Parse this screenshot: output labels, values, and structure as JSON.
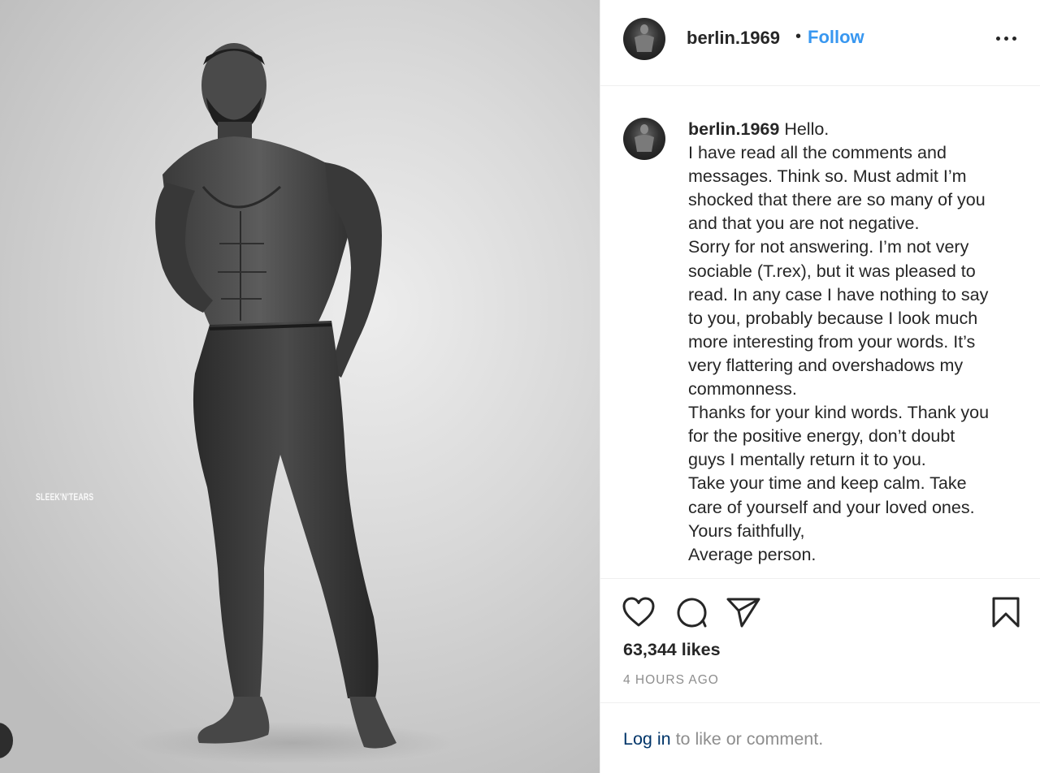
{
  "photo": {
    "watermark": "SLEEK'N'TEARS",
    "alt_subject": "black-and-white photo of a muscular man in jeans"
  },
  "header": {
    "username": "berlin.1969",
    "separator": "•",
    "follow_label": "Follow"
  },
  "caption": {
    "username": "berlin.1969",
    "lines": [
      " Hello.",
      "I have read all the comments and",
      "messages. Think so. Must admit I’m",
      "shocked that there are so many of you",
      "and that you are not negative.",
      "Sorry for not answering. I’m not very",
      "sociable (T.rex), but it was pleased to",
      "read. In any case I have nothing to say",
      "to you, probably because I look much",
      "more interesting from your words. It’s",
      "very flattering and overshadows my",
      "commonness.",
      "Thanks for your kind words. Thank you",
      "for the positive energy, don’t doubt",
      "guys I mentally return it to you.",
      "Take your time and keep calm. Take",
      "care of yourself and your loved ones.",
      "Yours faithfully,",
      "Average person."
    ]
  },
  "actions": {
    "icons": [
      "heart-icon",
      "comment-icon",
      "share-icon",
      "bookmark-icon"
    ],
    "likes": "63,344 likes",
    "time_ago": "4 HOURS AGO"
  },
  "footer": {
    "login_link": "Log in",
    "login_suffix": " to like or comment."
  },
  "colors": {
    "link_blue": "#3897f0",
    "login_blue": "#003569",
    "text": "#262626",
    "muted": "#8e8e8e",
    "divider": "#efefef"
  }
}
